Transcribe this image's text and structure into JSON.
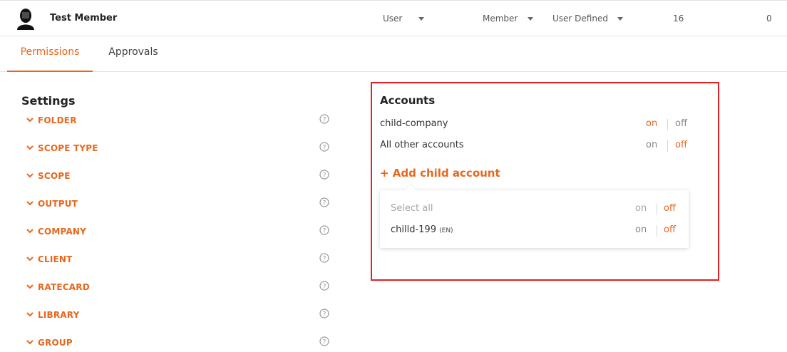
{
  "header": {
    "member_name": "Test Member",
    "role_select": "User",
    "type_select": "Member",
    "definition_select": "User Defined",
    "count_a": "16",
    "count_b": "0"
  },
  "tabs": [
    {
      "label": "Permissions",
      "active": true
    },
    {
      "label": "Approvals",
      "active": false
    }
  ],
  "settings": {
    "title": "Settings",
    "items": [
      {
        "label": "FOLDER"
      },
      {
        "label": "SCOPE TYPE"
      },
      {
        "label": "SCOPE"
      },
      {
        "label": "OUTPUT"
      },
      {
        "label": "COMPANY"
      },
      {
        "label": "CLIENT"
      },
      {
        "label": "RATECARD"
      },
      {
        "label": "LIBRARY"
      },
      {
        "label": "GROUP"
      }
    ]
  },
  "accounts": {
    "title": "Accounts",
    "rows": [
      {
        "name": "child-company",
        "on": "on",
        "off": "off",
        "selected": "on"
      },
      {
        "name": "All other accounts",
        "on": "on",
        "off": "off",
        "selected": "off"
      }
    ],
    "add_child_label": "+ Add child account",
    "popup": {
      "select_all": {
        "name": "Select all",
        "on": "on",
        "off": "off",
        "selected": "off"
      },
      "rows": [
        {
          "name": "chilld-199",
          "lang": "(EN)",
          "on": "on",
          "off": "off",
          "selected": "off"
        }
      ]
    }
  },
  "colors": {
    "accent": "#e8671c",
    "highlight_border": "#e31e24"
  }
}
